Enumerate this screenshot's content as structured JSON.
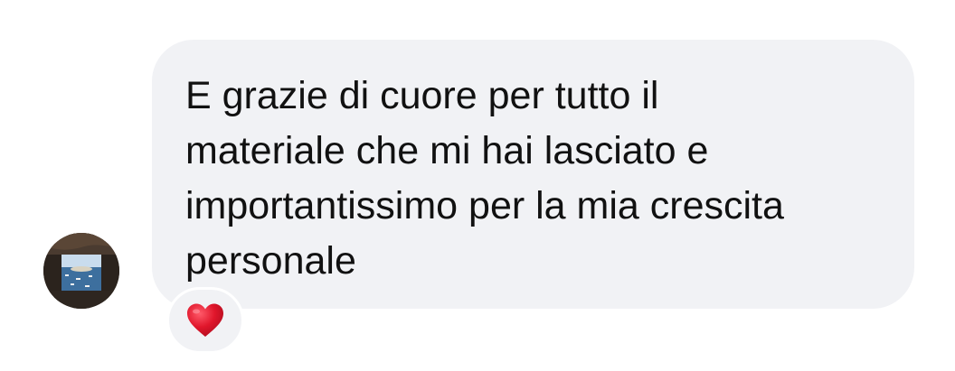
{
  "message": {
    "lines": [
      "E grazie di cuore per tutto il",
      "materiale che mi hai lasciato e",
      "importantissimo per la mia crescita",
      "personale"
    ]
  },
  "reaction": {
    "icon": "red-heart-icon",
    "color": "#e0162b"
  },
  "avatar": {
    "icon": "profile-photo"
  },
  "colors": {
    "bubble": "#f1f2f5",
    "text": "#111111",
    "background": "#ffffff"
  }
}
